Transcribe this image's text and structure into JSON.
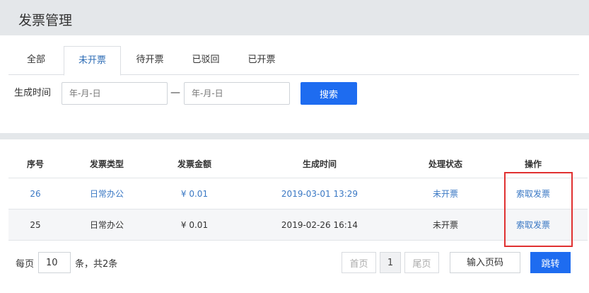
{
  "page": {
    "title": "发票管理"
  },
  "tabs": [
    {
      "label": "全部"
    },
    {
      "label": "未开票",
      "active": true
    },
    {
      "label": "待开票"
    },
    {
      "label": "已驳回"
    },
    {
      "label": "已开票"
    }
  ],
  "filter": {
    "date_label": "生成时间",
    "start_placeholder": "年-月-日",
    "separator": "—",
    "end_placeholder": "年-月-日",
    "search_label": "搜索"
  },
  "table": {
    "headers": [
      "序号",
      "发票类型",
      "发票金额",
      "生成时间",
      "处理状态",
      "操作"
    ],
    "rows": [
      {
        "seq": "26",
        "type": "日常办公",
        "amount": "¥ 0.01",
        "time": "2019-03-01 13:29",
        "status": "未开票",
        "action": "索取发票"
      },
      {
        "seq": "25",
        "type": "日常办公",
        "amount": "¥ 0.01",
        "time": "2019-02-26 16:14",
        "status": "未开票",
        "action": "索取发票"
      }
    ]
  },
  "pagination": {
    "per_page_prefix": "每页",
    "per_page_value": "10",
    "per_page_suffix": "条，共2条",
    "first_label": "首页",
    "current_page": "1",
    "last_label": "尾页",
    "goto_placeholder": "输入页码",
    "jump_label": "跳转"
  },
  "colors": {
    "primary": "#1e6cf0",
    "link": "#3a78c4",
    "highlight": "#e03131"
  }
}
